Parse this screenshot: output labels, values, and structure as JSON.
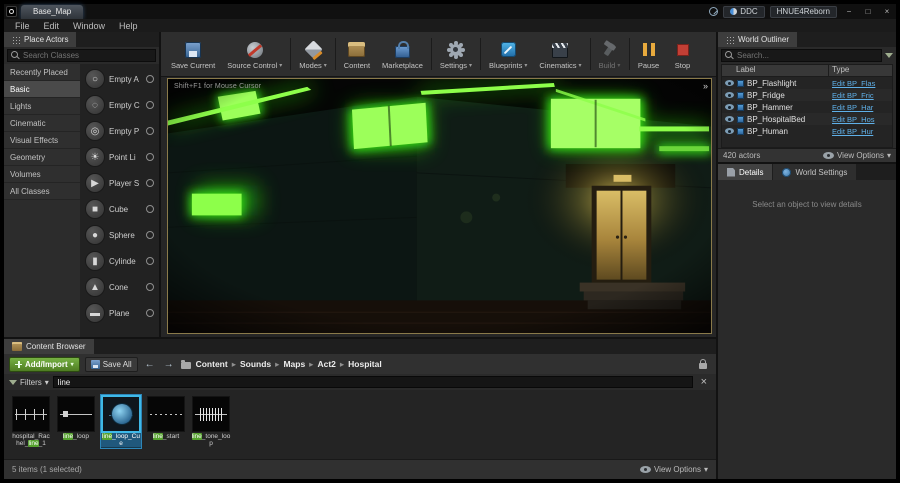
{
  "colors": {
    "accent_green": "#7dff3d",
    "add_import_green": "#5a8f2e",
    "hyperlink_blue": "#5fb0e8",
    "selection_teal": "#3fb9e8",
    "filter_match_green": "#55a12e"
  },
  "titlebar": {
    "tab_title": "Base_Map",
    "ddc_label": "DDC",
    "session_label": "HNUE4Reborn",
    "window_controls": {
      "minimize": "−",
      "maximize": "□",
      "close": "×"
    }
  },
  "menubar": {
    "items": [
      "File",
      "Edit",
      "Window",
      "Help"
    ]
  },
  "place_actors": {
    "title": "Place Actors",
    "search_placeholder": "Search Classes",
    "categories": [
      {
        "label": "Recently Placed"
      },
      {
        "label": "Basic",
        "active": true
      },
      {
        "label": "Lights"
      },
      {
        "label": "Cinematic"
      },
      {
        "label": "Visual Effects"
      },
      {
        "label": "Geometry"
      },
      {
        "label": "Volumes"
      },
      {
        "label": "All Classes"
      }
    ],
    "items": [
      {
        "label": "Empty A",
        "icon": "empty-actor-icon",
        "glyph": "○"
      },
      {
        "label": "Empty C",
        "icon": "empty-character-icon",
        "glyph": "◌"
      },
      {
        "label": "Empty P",
        "icon": "empty-pawn-icon",
        "glyph": "◎"
      },
      {
        "label": "Point Li",
        "icon": "point-light-icon",
        "glyph": "☀"
      },
      {
        "label": "Player S",
        "icon": "player-start-icon",
        "glyph": "▶"
      },
      {
        "label": "Cube",
        "icon": "cube-icon",
        "glyph": "■"
      },
      {
        "label": "Sphere",
        "icon": "sphere-icon",
        "glyph": "●"
      },
      {
        "label": "Cylinde",
        "icon": "cylinder-icon",
        "glyph": "▮"
      },
      {
        "label": "Cone",
        "icon": "cone-icon",
        "glyph": "▲"
      },
      {
        "label": "Plane",
        "icon": "plane-icon",
        "glyph": "▬"
      }
    ]
  },
  "toolbar": {
    "buttons": [
      {
        "label": "Save Current",
        "icon": "save-current-icon"
      },
      {
        "label": "Source Control",
        "icon": "source-control-icon",
        "caret": true
      },
      {
        "sep": true,
        "icon": "toolbar-separator"
      },
      {
        "label": "Modes",
        "icon": "modes-icon",
        "caret": true
      },
      {
        "sep": true,
        "icon": "toolbar-separator"
      },
      {
        "label": "Content",
        "icon": "content-icon"
      },
      {
        "label": "Marketplace",
        "icon": "marketplace-icon"
      },
      {
        "sep": true,
        "icon": "toolbar-separator"
      },
      {
        "label": "Settings",
        "icon": "settings-icon",
        "caret": true
      },
      {
        "sep": true,
        "icon": "toolbar-separator"
      },
      {
        "label": "Blueprints",
        "icon": "blueprints-icon",
        "caret": true
      },
      {
        "label": "Cinematics",
        "icon": "cinematics-icon",
        "caret": true
      },
      {
        "sep": true,
        "icon": "toolbar-separator"
      },
      {
        "label": "Build",
        "icon": "build-icon",
        "caret": true,
        "disabled": true
      },
      {
        "sep": true,
        "icon": "toolbar-separator"
      },
      {
        "label": "Pause",
        "icon": "pause-icon"
      },
      {
        "label": "Stop",
        "icon": "stop-icon"
      }
    ]
  },
  "viewport": {
    "overlay_hint": "Shift+F1 for Mouse Cursor",
    "expand_chevrons": "»"
  },
  "world_outliner": {
    "title": "World Outliner",
    "search_placeholder": "Search...",
    "columns": {
      "label": "Label",
      "type": "Type"
    },
    "rows": [
      {
        "label": "BP_Flashlight",
        "type_link": "Edit BP_Flas"
      },
      {
        "label": "BP_Fridge",
        "type_link": "Edit BP_Fric"
      },
      {
        "label": "BP_Hammer",
        "type_link": "Edit BP_Har"
      },
      {
        "label": "BP_HospitalBed",
        "type_link": "Edit BP_Hos"
      },
      {
        "label": "BP_Human",
        "type_link": "Edit BP_Hur"
      }
    ],
    "footer_count": "420 actors",
    "view_options_label": "View Options"
  },
  "details_panel": {
    "tabs": [
      {
        "label": "Details",
        "icon": "details-tab-icon",
        "active": true
      },
      {
        "label": "World Settings",
        "icon": "world-settings-icon"
      }
    ],
    "empty_message": "Select an object to view details"
  },
  "content_browser": {
    "title": "Content Browser",
    "add_import_label": "Add/Import",
    "save_all_label": "Save All",
    "breadcrumb": [
      "Content",
      "Sounds",
      "Maps",
      "Act2",
      "Hospital"
    ],
    "filters_label": "Filters",
    "filter_value": "line",
    "assets": [
      {
        "name": "hospital_Rachel_line_1",
        "thumb": "wave-sparse"
      },
      {
        "name": "line_loop",
        "thumb": "wave-flat"
      },
      {
        "name": "line_loop_Cue",
        "thumb": "wave-cue",
        "selected": true
      },
      {
        "name": "line_start",
        "thumb": "wave-dashed"
      },
      {
        "name": "line_tone_loop",
        "thumb": "wave-dense"
      }
    ],
    "status_text": "5 items (1 selected)",
    "view_options_label": "View Options"
  }
}
